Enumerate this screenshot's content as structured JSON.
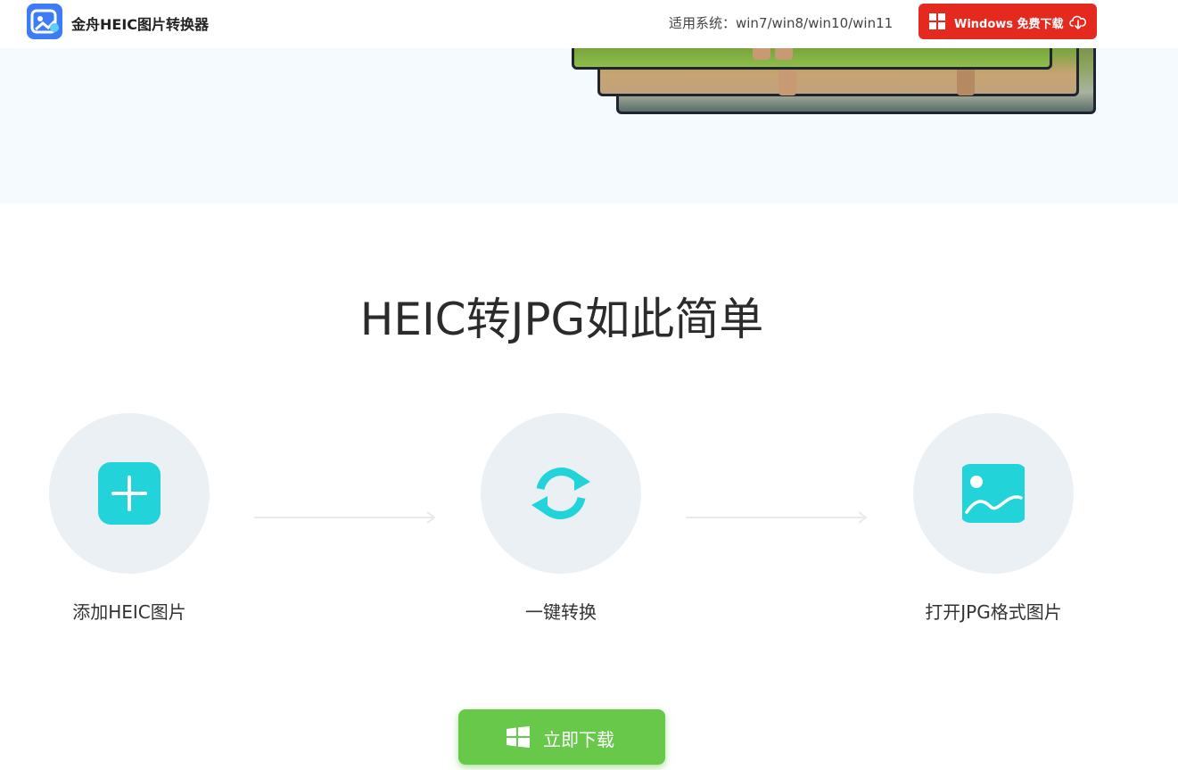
{
  "header": {
    "app_name": "金舟HEIC图片转换器",
    "logo_icon": "photo-app-logo-icon",
    "system_info": "适用系统：win7/win8/win10/win11",
    "download_button": {
      "label": "Windows 免费下载",
      "icon_left": "windows-icon",
      "icon_right": "cloud-download-icon"
    }
  },
  "hero": {
    "images": [
      "photo-preview-1",
      "photo-preview-2",
      "photo-preview-3"
    ]
  },
  "steps_section": {
    "title": "HEIC转JPG如此简单",
    "steps": [
      {
        "label": "添加HEIC图片",
        "icon": "add-image-icon"
      },
      {
        "label": "一键转换",
        "icon": "convert-refresh-icon"
      },
      {
        "label": "打开JPG格式图片",
        "icon": "open-image-icon"
      }
    ],
    "download_button": {
      "label": "立即下载",
      "icon": "windows-icon"
    }
  },
  "colors": {
    "brand_red": "#e42a1f",
    "accent_cyan": "#22d3d9",
    "download_green": "#68c84a",
    "step_circle_bg": "#ebf0f4",
    "hero_bg": "#f5faff"
  }
}
